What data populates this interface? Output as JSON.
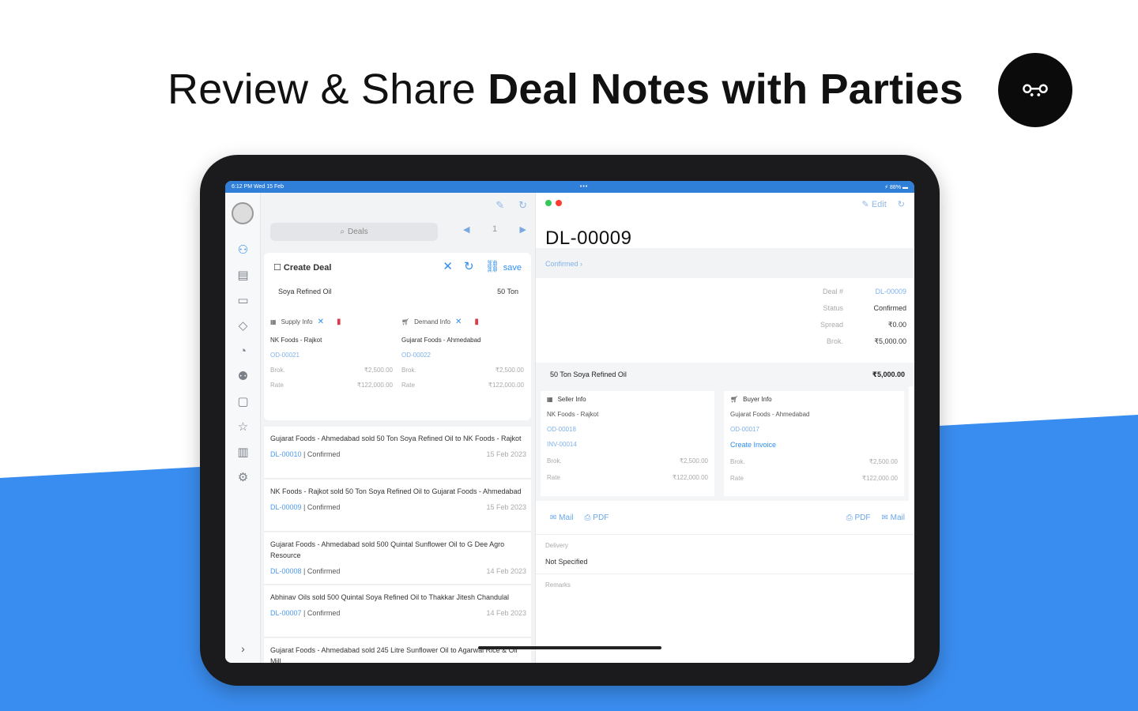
{
  "promo": {
    "headline_light": "Review & Share",
    "headline_bold": "Deal Notes with Parties",
    "logo_glyph": "ꗭ",
    "colors": {
      "accent_blue": "#3a8df0",
      "logo_bg": "#0b0b0b"
    }
  },
  "statusbar": {
    "time": "6:12 PM  Wed 15 Feb",
    "center": "•••",
    "battery": "⚡ 88% ▬"
  },
  "rail": {
    "icons": [
      "handshake-icon",
      "document-icon",
      "monitor-icon",
      "tag-icon",
      "pie-chart-icon",
      "people-icon",
      "wallet-icon",
      "star-icon",
      "building-icon",
      "gear-icon"
    ],
    "chevron": "›"
  },
  "list": {
    "search_placeholder": "Deals",
    "page": "1",
    "create_card": {
      "title": "Create Deal",
      "save_label": "save",
      "product": "Soya Refined Oil",
      "quantity": "50 Ton",
      "supply": {
        "label": "Supply Info",
        "party": "NK Foods - Rajkot",
        "code": "OD-00021",
        "brok_label": "Brok.",
        "brok_value": "₹2,500.00",
        "rate_label": "Rate",
        "rate_value": "₹122,000.00"
      },
      "demand": {
        "label": "Demand Info",
        "party": "Gujarat Foods - Ahmedabad",
        "code": "OD-00022",
        "brok_label": "Brok.",
        "brok_value": "₹2,500.00",
        "rate_label": "Rate",
        "rate_value": "₹122,000.00"
      }
    },
    "items": [
      {
        "title": "Gujarat Foods - Ahmedabad sold 50 Ton Soya Refined Oil to NK Foods - Rajkot",
        "id": "DL-00010",
        "status": "| Confirmed",
        "date": "15 Feb 2023"
      },
      {
        "title": "NK Foods - Rajkot sold 50 Ton Soya Refined Oil to Gujarat Foods - Ahmedabad",
        "id": "DL-00009",
        "status": "| Confirmed",
        "date": "15 Feb 2023"
      },
      {
        "title": "Gujarat Foods - Ahmedabad sold 500 Quintal Sunflower Oil to G Dee Agro Resource",
        "id": "DL-00008",
        "status": "| Confirmed",
        "date": "14 Feb 2023"
      },
      {
        "title": "Abhinav Oils sold 500 Quintal Soya Refined Oil to Thakkar Jitesh Chandulal",
        "id": "DL-00007",
        "status": "| Confirmed",
        "date": "14 Feb 2023"
      },
      {
        "title": "Gujarat Foods - Ahmedabad sold 245 Litre Sunflower Oil to Agarwal Rice & Oil Mill",
        "id": "",
        "status": "",
        "date": ""
      }
    ]
  },
  "detail": {
    "edit_label": "Edit",
    "deal_id": "DL-00009",
    "status_link": "Confirmed",
    "meta": [
      {
        "key": "Deal #",
        "value": "DL-00009"
      },
      {
        "key": "Status",
        "value": "Confirmed"
      },
      {
        "key": "Spread",
        "value": "₹0.00"
      },
      {
        "key": "Brok.",
        "value": "₹5,000.00"
      }
    ],
    "summary_text": "50 Ton Soya Refined Oil",
    "summary_amount": "₹5,000.00",
    "seller": {
      "label": "Seller Info",
      "party": "NK Foods - Rajkot",
      "code1": "OD-00018",
      "code2": "INV-00014",
      "brok_label": "Brok.",
      "brok_value": "₹2,500.00",
      "rate_label": "Rate",
      "rate_value": "₹122,000.00"
    },
    "buyer": {
      "label": "Buyer Info",
      "party": "Gujarat Foods - Ahmedabad",
      "code1": "OD-00017",
      "create_invoice": "Create Invoice",
      "brok_label": "Brok.",
      "brok_value": "₹2,500.00",
      "rate_label": "Rate",
      "rate_value": "₹122,000.00"
    },
    "share": {
      "mail": "Mail",
      "pdf": "PDF"
    },
    "delivery_label": "Delivery",
    "delivery_value": "Not Specified",
    "remarks_label": "Remarks"
  }
}
